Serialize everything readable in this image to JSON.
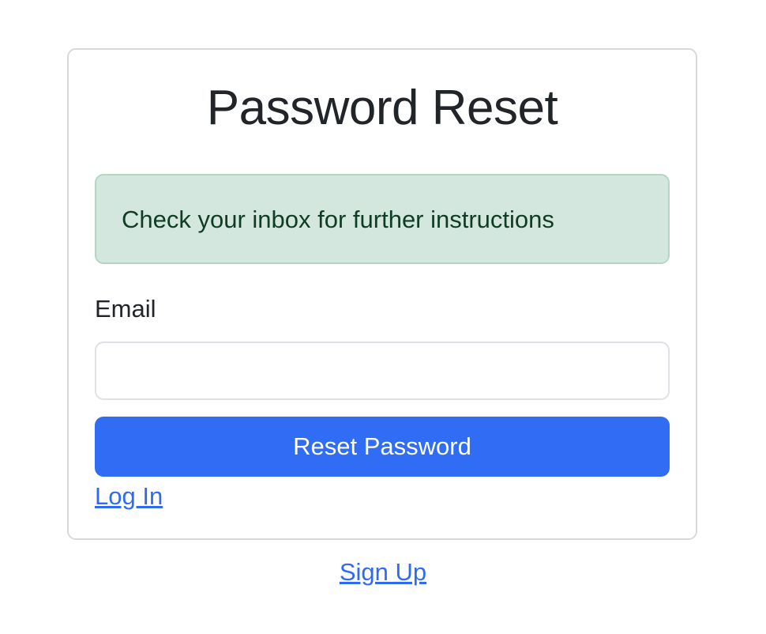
{
  "card": {
    "title": "Password Reset",
    "alert": {
      "message": "Check your inbox for further instructions",
      "type": "success",
      "background_color": "#d4e7de",
      "text_color": "#0f3d24"
    },
    "email_field": {
      "label": "Email",
      "value": "",
      "placeholder": ""
    },
    "submit_button": {
      "label": "Reset Password",
      "color": "#316cf4"
    },
    "login_link": "Log In"
  },
  "footer": {
    "signup_link": "Sign Up"
  },
  "colors": {
    "link": "#2f6bf2",
    "card_border": "#d9d9d9"
  }
}
